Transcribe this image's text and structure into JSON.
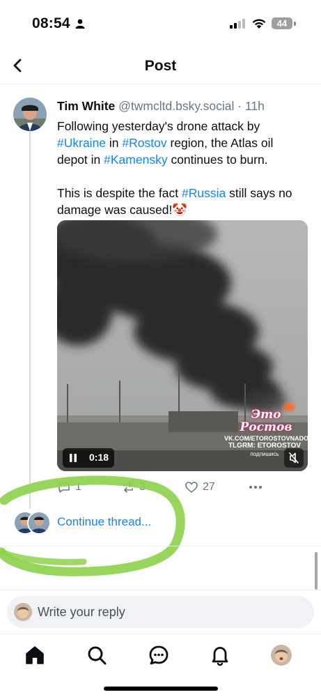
{
  "status_bar": {
    "time": "08:54",
    "battery": "44"
  },
  "header": {
    "title": "Post"
  },
  "post": {
    "author_name": "Tim White",
    "author_handle": "@twmcltd.bsky.social",
    "separator": "·",
    "time_ago": "11h",
    "text": {
      "p1_a": "Following yesterday's drone attack by ",
      "tag_ukraine": "#Ukraine",
      "p1_b": " in ",
      "tag_rostov": "#Rostov",
      "p1_c": " region, the Atlas oil depot in ",
      "tag_kamensky": "#Kamensky",
      "p1_d": " continues to burn.",
      "p2_a": "This is despite the fact ",
      "tag_russia": "#Russia",
      "p2_b": " still says no damage was caused!",
      "emoji": "🤡"
    },
    "media": {
      "video_time": "0:18",
      "watermark_logo": "Это Ростов",
      "watermark_line1": "VK.COM/ETOROSTOVNADONU",
      "watermark_line2": "TLGRM: ETOROSTOV",
      "watermark_line3": "подпишись"
    },
    "actions": {
      "replies": "1",
      "reposts": "3",
      "likes": "27"
    }
  },
  "continue_thread": {
    "label": "Continue thread..."
  },
  "reply_bar": {
    "placeholder": "Write your reply"
  },
  "colors": {
    "accent": "#1083fe",
    "muted": "#6b7783",
    "highlight": "#8fd14f"
  },
  "nav": {
    "items": [
      "home-icon",
      "search-icon",
      "chat-icon",
      "notifications-icon",
      "profile-avatar"
    ]
  }
}
